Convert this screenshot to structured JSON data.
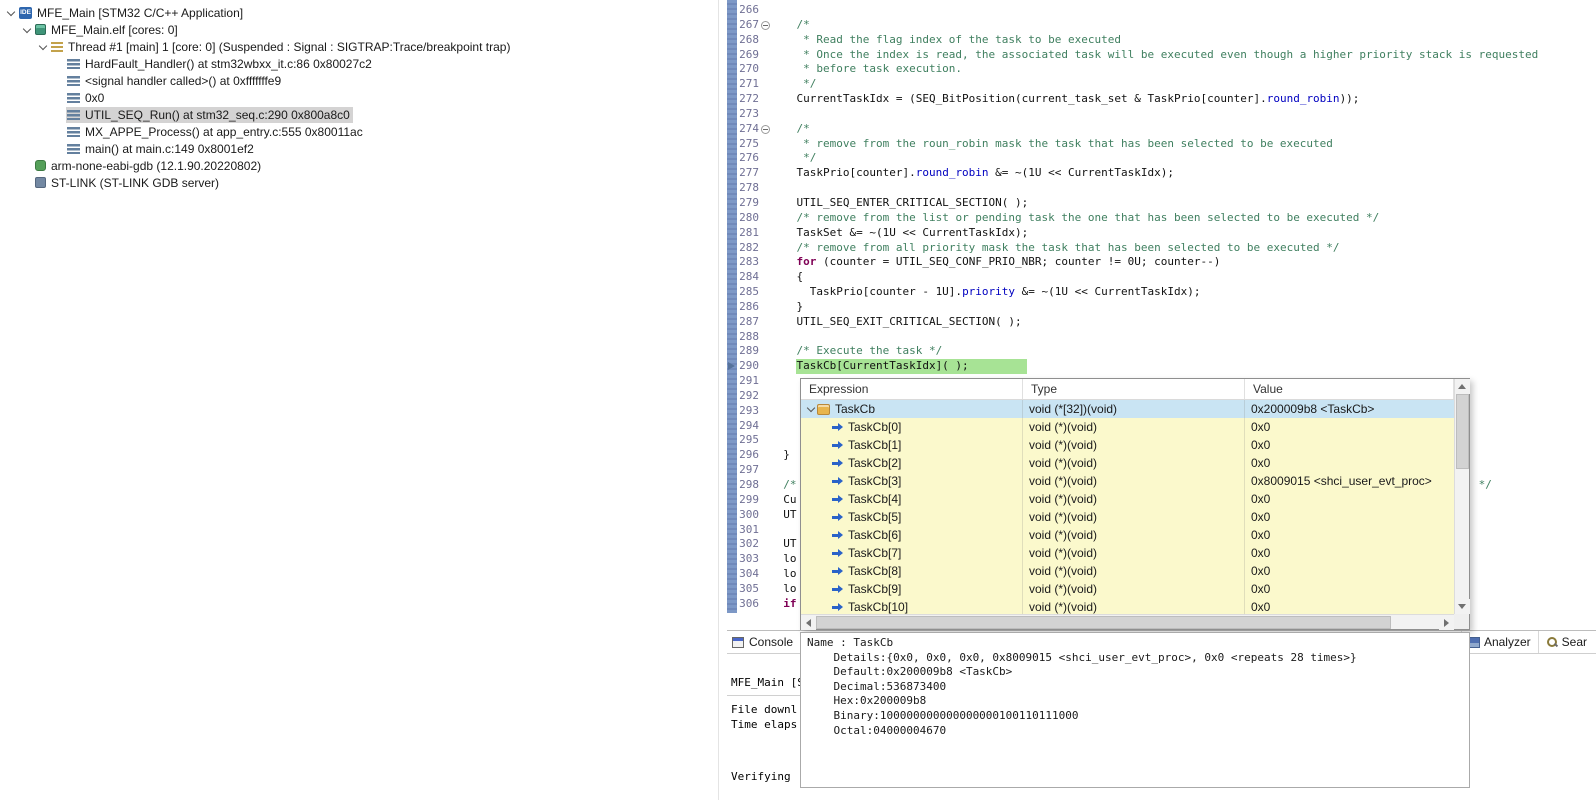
{
  "colors": {
    "current_line_highlight": "#a7e395",
    "tree_selection": "#d4d3d3",
    "tooltip_row_bg": "#fbf9cc",
    "tooltip_selected_bg": "#c9e4f3",
    "syntax_comment": "#3f7f5f",
    "syntax_keyword": "#7f0055",
    "syntax_member": "#0000c0",
    "quickdiff_strip": "#7d98c6"
  },
  "debug_tree": {
    "items": [
      {
        "label": "MFE_Main [STM32 C/C++ Application]",
        "level": 0,
        "expander": true,
        "icon": "ide-badge-icon"
      },
      {
        "label": "MFE_Main.elf [cores: 0]",
        "level": 1,
        "expander": true,
        "icon": "elf-binary-icon"
      },
      {
        "label": "Thread #1 [main] 1 [core: 0] (Suspended : Signal : SIGTRAP:Trace/breakpoint trap)",
        "level": 2,
        "expander": true,
        "icon": "thread-icon"
      },
      {
        "label": "HardFault_Handler() at stm32wbxx_it.c:86 0x80027c2",
        "level": 3,
        "expander": false,
        "icon": "stack-frame-icon"
      },
      {
        "label": "<signal handler called>() at 0xfffffffe9",
        "level": 3,
        "expander": false,
        "icon": "stack-frame-icon"
      },
      {
        "label": "0x0",
        "level": 3,
        "expander": false,
        "icon": "stack-frame-icon"
      },
      {
        "label": "UTIL_SEQ_Run() at stm32_seq.c:290 0x800a8c0",
        "level": 3,
        "expander": false,
        "icon": "stack-frame-icon",
        "selected": true
      },
      {
        "label": "MX_APPE_Process() at app_entry.c:555 0x80011ac",
        "level": 3,
        "expander": false,
        "icon": "stack-frame-icon"
      },
      {
        "label": "main() at main.c:149 0x8001ef2",
        "level": 3,
        "expander": false,
        "icon": "stack-frame-icon"
      },
      {
        "label": "arm-none-eabi-gdb (12.1.90.20220802)",
        "level": 1,
        "expander": false,
        "icon": "debugger-icon"
      },
      {
        "label": "ST-LINK (ST-LINK GDB server)",
        "level": 1,
        "expander": false,
        "icon": "gdb-server-icon"
      }
    ]
  },
  "editor": {
    "lines": [
      {
        "n": 266,
        "seg": []
      },
      {
        "n": 267,
        "f": 1,
        "seg": [
          [
            "c",
            "    /*"
          ]
        ]
      },
      {
        "n": 268,
        "seg": [
          [
            "c",
            "     * Read the flag index of the task to be executed"
          ]
        ]
      },
      {
        "n": 269,
        "seg": [
          [
            "c",
            "     * Once the index is read, the associated task will be executed even though a higher priority stack is requested"
          ]
        ]
      },
      {
        "n": 270,
        "seg": [
          [
            "c",
            "     * before task execution."
          ]
        ]
      },
      {
        "n": 271,
        "seg": [
          [
            "c",
            "     */"
          ]
        ]
      },
      {
        "n": 272,
        "seg": [
          [
            "p",
            "    CurrentTaskIdx = (SEQ_BitPosition(current_task_set & TaskPrio[counter]."
          ],
          [
            "m",
            "round_robin"
          ],
          [
            "p",
            "));"
          ]
        ]
      },
      {
        "n": 273,
        "seg": []
      },
      {
        "n": 274,
        "f": 1,
        "seg": [
          [
            "c",
            "    /*"
          ]
        ]
      },
      {
        "n": 275,
        "seg": [
          [
            "c",
            "     * remove from the roun_robin mask the task that has been selected to be executed"
          ]
        ]
      },
      {
        "n": 276,
        "seg": [
          [
            "c",
            "     */"
          ]
        ]
      },
      {
        "n": 277,
        "seg": [
          [
            "p",
            "    TaskPrio[counter]."
          ],
          [
            "m",
            "round_robin"
          ],
          [
            "p",
            " &= ~(1U << CurrentTaskIdx);"
          ]
        ]
      },
      {
        "n": 278,
        "seg": []
      },
      {
        "n": 279,
        "seg": [
          [
            "p",
            "    UTIL_SEQ_ENTER_CRITICAL_SECTION( );"
          ]
        ]
      },
      {
        "n": 280,
        "seg": [
          [
            "p",
            "    "
          ],
          [
            "c",
            "/* remove from the list or pending task the one that has been selected to be executed */"
          ]
        ]
      },
      {
        "n": 281,
        "seg": [
          [
            "p",
            "    TaskSet &= ~(1U << CurrentTaskIdx);"
          ]
        ]
      },
      {
        "n": 282,
        "seg": [
          [
            "p",
            "    "
          ],
          [
            "c",
            "/* remove from all priority mask the task that has been selected to be executed */"
          ]
        ]
      },
      {
        "n": 283,
        "seg": [
          [
            "p",
            "    "
          ],
          [
            "k",
            "for"
          ],
          [
            "p",
            " (counter = UTIL_SEQ_CONF_PRIO_NBR; counter != 0U; counter--)"
          ]
        ]
      },
      {
        "n": 284,
        "seg": [
          [
            "p",
            "    {"
          ]
        ]
      },
      {
        "n": 285,
        "seg": [
          [
            "p",
            "      TaskPrio[counter - 1U]."
          ],
          [
            "m",
            "priority"
          ],
          [
            "p",
            " &= ~(1U << CurrentTaskIdx);"
          ]
        ]
      },
      {
        "n": 286,
        "seg": [
          [
            "p",
            "    }"
          ]
        ]
      },
      {
        "n": 287,
        "seg": [
          [
            "p",
            "    UTIL_SEQ_EXIT_CRITICAL_SECTION( );"
          ]
        ]
      },
      {
        "n": 288,
        "seg": []
      },
      {
        "n": 289,
        "seg": [
          [
            "p",
            "    "
          ],
          [
            "c",
            "/* Execute the task */"
          ]
        ]
      },
      {
        "n": 290,
        "cur": 1,
        "seg": [
          [
            "p",
            "    TaskCb[CurrentTaskIdx]( );"
          ]
        ]
      },
      {
        "n": 291,
        "seg": []
      },
      {
        "n": 292,
        "seg": []
      },
      {
        "n": 293,
        "seg": []
      },
      {
        "n": 294,
        "seg": []
      },
      {
        "n": 295,
        "seg": []
      },
      {
        "n": 296,
        "seg": [
          [
            "p",
            "  }"
          ]
        ]
      },
      {
        "n": 297,
        "seg": []
      },
      {
        "n": 298,
        "seg": [
          [
            "c",
            "  /*                                                                                                       */"
          ]
        ]
      },
      {
        "n": 299,
        "seg": [
          [
            "p",
            "  Cu"
          ]
        ]
      },
      {
        "n": 300,
        "seg": [
          [
            "p",
            "  UT"
          ]
        ]
      },
      {
        "n": 301,
        "seg": []
      },
      {
        "n": 302,
        "seg": [
          [
            "p",
            "  UT"
          ]
        ]
      },
      {
        "n": 303,
        "seg": [
          [
            "p",
            "  lo"
          ]
        ]
      },
      {
        "n": 304,
        "seg": [
          [
            "p",
            "  lo"
          ]
        ]
      },
      {
        "n": 305,
        "seg": [
          [
            "p",
            "  lo"
          ]
        ]
      },
      {
        "n": 306,
        "seg": [
          [
            "p",
            "  "
          ],
          [
            "k",
            "if"
          ]
        ]
      }
    ]
  },
  "expressions_popup": {
    "columns": [
      "Expression",
      "Type",
      "Value"
    ],
    "rows": [
      {
        "expression": "TaskCb",
        "type": "void (*[32])(void)",
        "value": "0x200009b8 <TaskCb>",
        "selected": true,
        "expander": true,
        "icon": "expression-icon"
      },
      {
        "expression": "TaskCb[0]",
        "type": "void (*)(void)",
        "value": "0x0",
        "icon": "variable-pointer-icon"
      },
      {
        "expression": "TaskCb[1]",
        "type": "void (*)(void)",
        "value": "0x0",
        "icon": "variable-pointer-icon"
      },
      {
        "expression": "TaskCb[2]",
        "type": "void (*)(void)",
        "value": "0x0",
        "icon": "variable-pointer-icon"
      },
      {
        "expression": "TaskCb[3]",
        "type": "void (*)(void)",
        "value": "0x8009015 <shci_user_evt_proc>",
        "icon": "variable-pointer-icon"
      },
      {
        "expression": "TaskCb[4]",
        "type": "void (*)(void)",
        "value": "0x0",
        "icon": "variable-pointer-icon"
      },
      {
        "expression": "TaskCb[5]",
        "type": "void (*)(void)",
        "value": "0x0",
        "icon": "variable-pointer-icon"
      },
      {
        "expression": "TaskCb[6]",
        "type": "void (*)(void)",
        "value": "0x0",
        "icon": "variable-pointer-icon"
      },
      {
        "expression": "TaskCb[7]",
        "type": "void (*)(void)",
        "value": "0x0",
        "icon": "variable-pointer-icon"
      },
      {
        "expression": "TaskCb[8]",
        "type": "void (*)(void)",
        "value": "0x0",
        "icon": "variable-pointer-icon"
      },
      {
        "expression": "TaskCb[9]",
        "type": "void (*)(void)",
        "value": "0x0",
        "icon": "variable-pointer-icon"
      },
      {
        "expression": "TaskCb[10]",
        "type": "void (*)(void)",
        "value": "0x0",
        "icon": "variable-pointer-icon"
      }
    ]
  },
  "detail_pane": {
    "lines": [
      "Name : TaskCb",
      "    Details:{0x0, 0x0, 0x0, 0x8009015 <shci_user_evt_proc>, 0x0 <repeats 28 times>}",
      "    Default:0x200009b8 <TaskCb>",
      "    Decimal:536873400",
      "    Hex:0x200009b8",
      "    Binary:100000000000000000100110111000",
      "    Octal:04000004670"
    ]
  },
  "console": {
    "tab_label": "Console",
    "lines": [
      "MFE_Main [ST",
      "File downl",
      "Time elaps",
      "Verifying "
    ]
  },
  "bottom_tabs": [
    {
      "label": "Analyzer",
      "icon": "analyzer-icon"
    },
    {
      "label": "Sear",
      "icon": "search-icon"
    }
  ]
}
